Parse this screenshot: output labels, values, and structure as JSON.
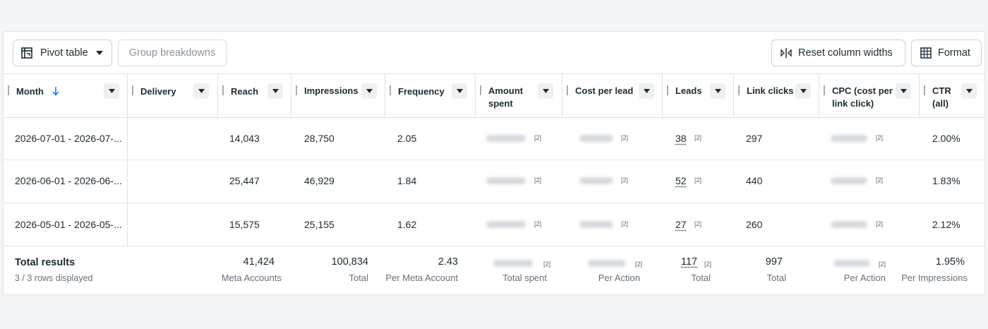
{
  "toolbar": {
    "pivot_label": "Pivot table",
    "group_label": "Group breakdowns",
    "reset_label": "Reset column widths",
    "format_label": "Format"
  },
  "columns": [
    {
      "label": "Month"
    },
    {
      "label": "Delivery"
    },
    {
      "label": "Reach"
    },
    {
      "label": "Impressions"
    },
    {
      "label": "Frequency"
    },
    {
      "label": "Amount spent"
    },
    {
      "label": "Cost per lead"
    },
    {
      "label": "Leads"
    },
    {
      "label": "Link clicks"
    },
    {
      "label": "CPC (cost per link click)"
    },
    {
      "label": "CTR (all)"
    }
  ],
  "rows": [
    {
      "month": "2026-07-01 - 2026-07-...",
      "reach": "14,043",
      "impressions": "28,750",
      "frequency": "2.05",
      "leads": "38",
      "link_clicks": "297",
      "ctr": "2.00%"
    },
    {
      "month": "2026-06-01 - 2026-06-...",
      "reach": "25,447",
      "impressions": "46,929",
      "frequency": "1.84",
      "leads": "52",
      "link_clicks": "440",
      "ctr": "1.83%"
    },
    {
      "month": "2026-05-01 - 2026-05-...",
      "reach": "15,575",
      "impressions": "25,155",
      "frequency": "1.62",
      "leads": "27",
      "link_clicks": "260",
      "ctr": "2.12%"
    }
  ],
  "note_marker": "[2]",
  "totals": {
    "title": "Total results",
    "rows_displayed": "3 / 3 rows displayed",
    "reach": "41,424",
    "reach_sub": "Meta Accounts",
    "impressions": "100,834",
    "impressions_sub": "Total",
    "frequency": "2.43",
    "frequency_sub": "Per Meta Account",
    "amount_sub": "Total spent",
    "cpl_sub": "Per Action",
    "leads": "117",
    "leads_sub": "Total",
    "link_clicks": "997",
    "link_clicks_sub": "Total",
    "cpc_sub": "Per Action",
    "ctr": "1.95%",
    "ctr_sub": "Per Impressions"
  },
  "colors": {
    "accent": "#1877f2",
    "text": "#1c2b33",
    "border": "#dfe1e5"
  },
  "icons": [
    "pivot-table-icon",
    "caret-down-icon",
    "reset-widths-icon",
    "format-grid-icon",
    "sort-down-arrow-icon",
    "column-grip-icon"
  ]
}
